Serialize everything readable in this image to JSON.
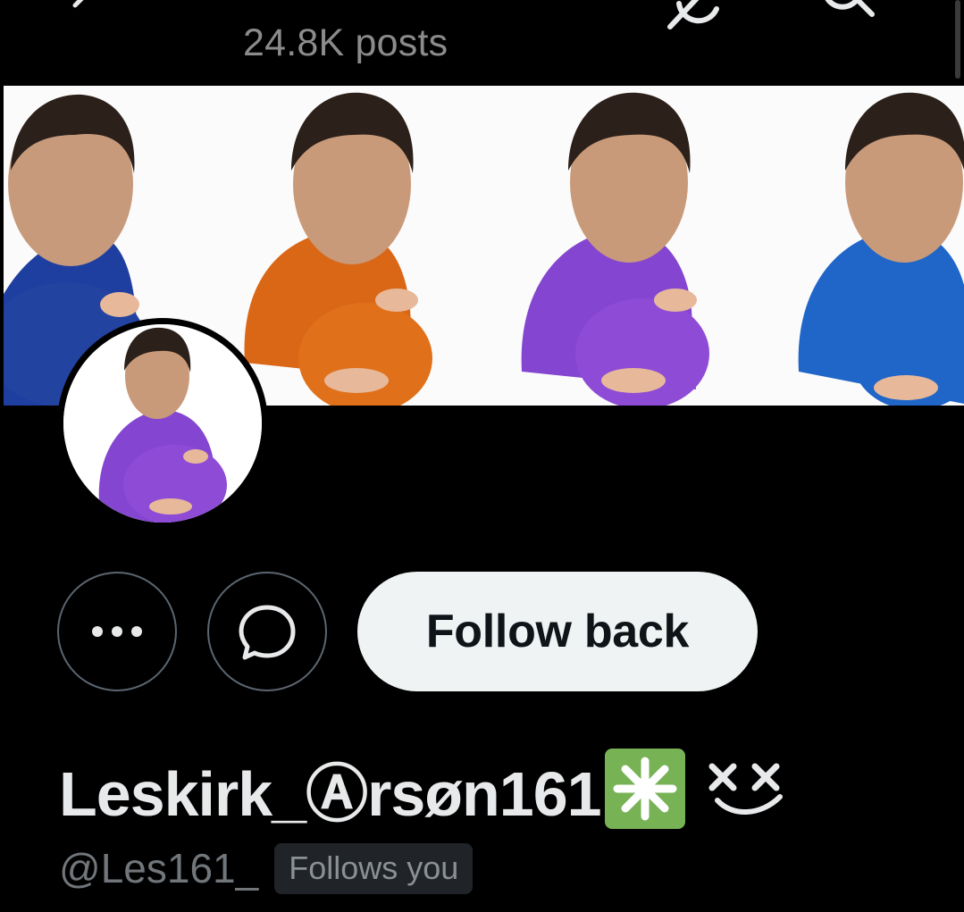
{
  "header": {
    "posts_count": "24.8K posts",
    "back_icon": "chevron-left-icon",
    "grok_icon": "grok-icon",
    "search_icon": "search-icon"
  },
  "banner": {
    "description_icon": "banner-image",
    "shirt_colors": [
      "#1f3fa0",
      "#e0711a",
      "#8e4bd6",
      "#1f66c8"
    ]
  },
  "avatar": {
    "icon": "profile-avatar",
    "shirt_color": "#8e4bd6"
  },
  "actions": {
    "more_label": "•••",
    "more_icon": "more-icon",
    "message_icon": "message-bubble-icon",
    "follow_label": "Follow back"
  },
  "profile": {
    "display_name": "Leskirk_Ⓐrsøn161",
    "sparkle_badge_icon": "sparkle-icon",
    "sparkle_badge_color": "#77b255",
    "xx_emoji_icon": "dizzy-face-icon",
    "handle": "@Les161_",
    "follows_you": "Follows you"
  }
}
